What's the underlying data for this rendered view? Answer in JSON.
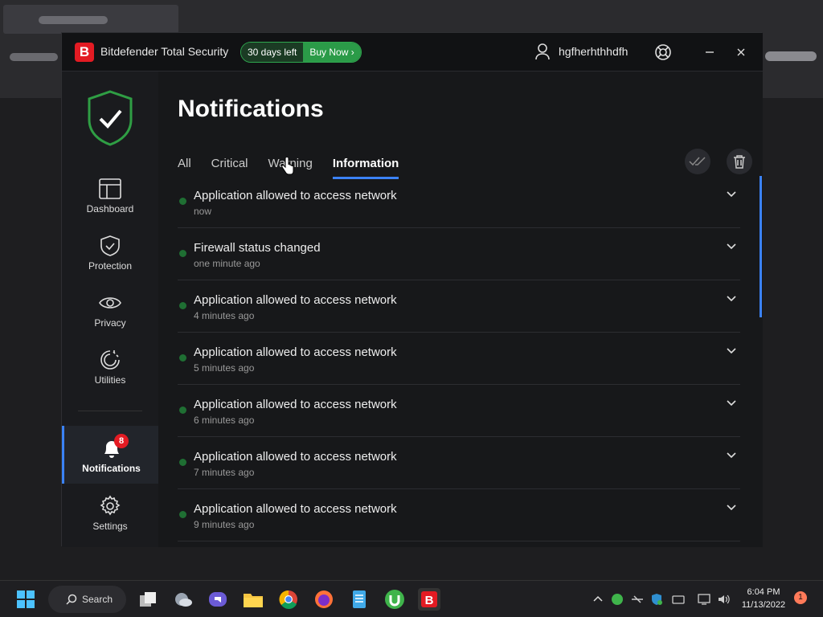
{
  "app": {
    "title": "Bitdefender Total Security",
    "logo_letter": "B",
    "trial_days": "30 days left",
    "buy_label": "Buy Now",
    "username": "hgfherhthhdfh"
  },
  "sidebar": {
    "items": [
      {
        "label": "Dashboard"
      },
      {
        "label": "Protection"
      },
      {
        "label": "Privacy"
      },
      {
        "label": "Utilities"
      },
      {
        "label": "Notifications",
        "badge": "8"
      },
      {
        "label": "Settings"
      }
    ]
  },
  "main": {
    "heading": "Notifications",
    "tabs": [
      {
        "label": "All"
      },
      {
        "label": "Critical"
      },
      {
        "label": "Warning"
      },
      {
        "label": "Information"
      }
    ],
    "notifications": [
      {
        "title": "Application allowed to access network",
        "time": "now"
      },
      {
        "title": "Firewall status changed",
        "time": "one minute ago"
      },
      {
        "title": "Application allowed to access network",
        "time": "4 minutes ago"
      },
      {
        "title": "Application allowed to access network",
        "time": "5 minutes ago"
      },
      {
        "title": "Application allowed to access network",
        "time": "6 minutes ago"
      },
      {
        "title": "Application allowed to access network",
        "time": "7 minutes ago"
      },
      {
        "title": "Application allowed to access network",
        "time": "9 minutes ago"
      }
    ]
  },
  "taskbar": {
    "search_label": "Search",
    "time": "6:04 PM",
    "date": "11/13/2022",
    "notification_count": "1"
  },
  "colors": {
    "accent": "#3b82f6",
    "brand_red": "#e31b23",
    "trial_green": "#2b9b48"
  }
}
